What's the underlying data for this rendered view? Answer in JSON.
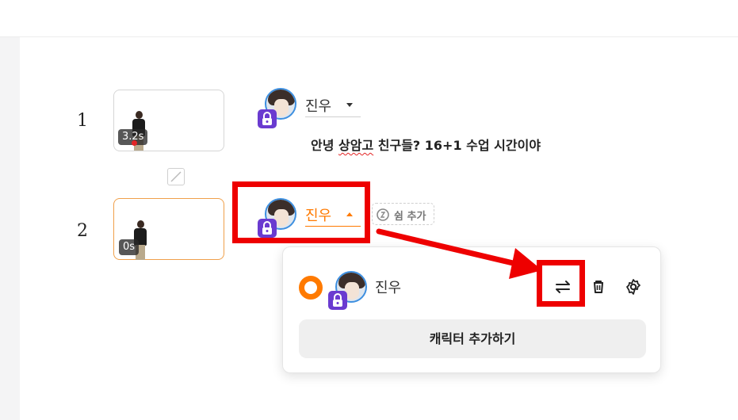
{
  "rows": [
    {
      "number": "1",
      "duration": "3.2s",
      "character": "진우",
      "dialogue_prefix": "안녕 ",
      "dialogue_misspelled": "상암고",
      "dialogue_suffix": " 친구들? 16+1 수업 시간이야"
    },
    {
      "number": "2",
      "duration": "0s",
      "character": "진우",
      "rest_label": "쉼 추가"
    }
  ],
  "popup": {
    "character": "진우",
    "add_character_label": "캐릭터 추가하기",
    "icons": [
      "swap-icon",
      "trash-icon",
      "gear-icon"
    ]
  },
  "colors": {
    "accent_orange": "#ff7a00",
    "lock_purple": "#6a3bd0",
    "annotation_red": "#ee0000"
  }
}
